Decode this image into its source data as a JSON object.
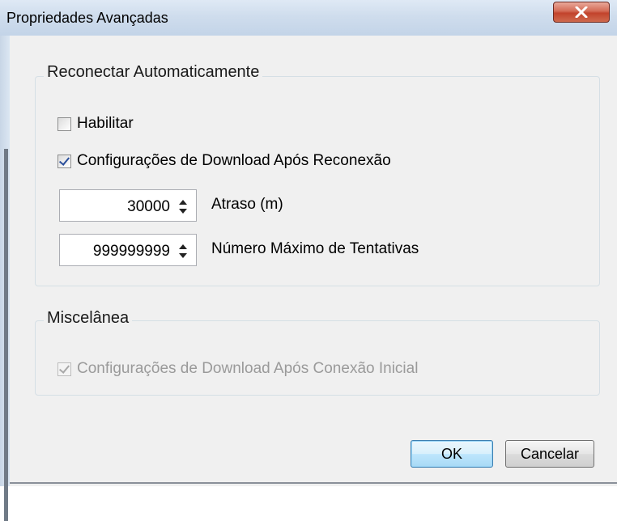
{
  "window": {
    "title": "Propriedades Avançadas"
  },
  "reconnect": {
    "group_label": "Reconectar Automaticamente",
    "enable_label": "Habilitar",
    "enable_checked": false,
    "download_after_reconnect_label": "Configurações de Download Após Reconexão",
    "download_after_reconnect_checked": true,
    "delay_value": "30000",
    "delay_label": "Atraso (m)",
    "max_attempts_value": "999999999",
    "max_attempts_label": "Número Máximo de Tentativas"
  },
  "misc": {
    "group_label": "Miscelânea",
    "download_after_initial_label": "Configurações de Download Após Conexão Inicial",
    "download_after_initial_checked": true,
    "download_after_initial_enabled": false
  },
  "buttons": {
    "ok_label": "OK",
    "cancel_label": "Cancelar"
  },
  "icons": {
    "close": "close-icon",
    "spin_up": "chevron-up-icon",
    "spin_down": "chevron-down-icon"
  },
  "colors": {
    "close_button": "#c7452e",
    "default_button_border": "#3c7fb1",
    "disabled_text": "#9a9a9a"
  }
}
